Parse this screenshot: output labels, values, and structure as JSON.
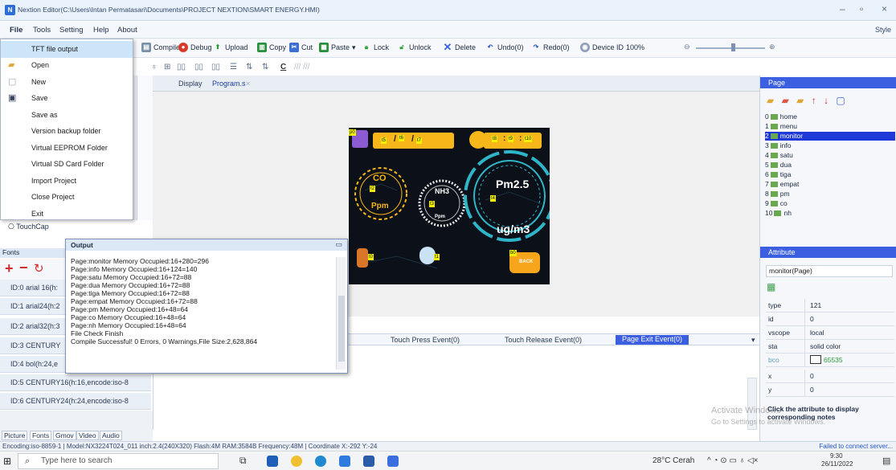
{
  "window": {
    "title": "Nextion Editor(C:\\Users\\Intan Permatasari\\Documents\\PROJECT NEXTION\\SMART ENERGY.HMI)",
    "style_label": "Style"
  },
  "menu": [
    "File",
    "Tools",
    "Setting",
    "Help",
    "About"
  ],
  "toolbar": {
    "compile": "Compile",
    "debug": "Debug",
    "upload": "Upload",
    "copy": "Copy",
    "cut": "Cut",
    "paste": "Paste",
    "lock": "Lock",
    "unlock": "Unlock",
    "delete": "Delete",
    "undo": "Undo(0)",
    "redo": "Redo(0)",
    "device_id": "Device ID",
    "zoom": "100%"
  },
  "file_menu": [
    {
      "label": "TFT file output",
      "icon": "none"
    },
    {
      "label": "Open",
      "icon": "folder-icon"
    },
    {
      "label": "New",
      "icon": "new-file-icon"
    },
    {
      "label": "Save",
      "icon": "save-icon"
    },
    {
      "label": "Save as",
      "icon": "none"
    },
    {
      "label": "Version backup folder",
      "icon": "none"
    },
    {
      "label": "Virtual EEPROM Folder",
      "icon": "none"
    },
    {
      "label": "Virtual SD Card Folder",
      "icon": "none"
    },
    {
      "label": "Import Project",
      "icon": "none"
    },
    {
      "label": "Close Project",
      "icon": "none"
    },
    {
      "label": "Exit",
      "icon": "none"
    }
  ],
  "toolbox": {
    "touchcap": "TouchCap"
  },
  "fonts_panel": {
    "header": "Fonts",
    "rows": [
      "ID:0 arial 16(h:",
      "ID:1 arial24(h:2",
      "ID:2 arial32(h:3",
      "ID:3 CENTURY",
      "ID:4 bol(h:24,e",
      "ID:5 CENTURY16(h:16,encode:iso-8",
      "ID:6 CENTURY24(h:24,encode:iso-8"
    ],
    "tabs": [
      "Picture",
      "Fonts",
      "Gmov",
      "Video",
      "Audio"
    ]
  },
  "doc_tabs": [
    "Display",
    "Program.s"
  ],
  "hmi_screen": {
    "date_tags": [
      "t5",
      "t6",
      "t7"
    ],
    "time_tags": [
      "t8",
      "t9",
      "t10"
    ],
    "co_label": "CO",
    "co_unit": "Ppm",
    "nh3_label": "NH3",
    "nh3_unit": "Ppm",
    "pm_label": "Pm2.5",
    "pm_unit": "ug/m3",
    "back_label": "BACK",
    "tag_t0": "t0",
    "tag_t2": "t2",
    "tag_t3": "t3",
    "tag_t4": "t4",
    "tag_t1": "t1",
    "tag_b0": "b0",
    "tag_p0": "p0"
  },
  "events": {
    "tabs": [
      "Touch Press Event(0)",
      "Touch Release Event(0)",
      "Page Exit Event(0)"
    ],
    "active": "Page Exit Event(0)"
  },
  "output": {
    "title": "Output",
    "lines": [
      "Page:monitor Memory Occupied:16+280=296",
      "Page:info Memory Occupied:16+124=140",
      "Page:satu Memory Occupied:16+72=88",
      "Page:dua Memory Occupied:16+72=88",
      "Page:tiga Memory Occupied:16+72=88",
      "Page:empat Memory Occupied:16+72=88",
      "Page:pm Memory Occupied:16+48=64",
      "Page:co Memory Occupied:16+48=64",
      "Page:nh Memory Occupied:16+48=64",
      "File Check Finish",
      "Compile Successful! 0 Errors, 0 Warnings,File Size:2,628,864"
    ]
  },
  "page_panel": {
    "header": "Page",
    "pages": [
      {
        "index": "0",
        "name": "home"
      },
      {
        "index": "1",
        "name": "menu"
      },
      {
        "index": "2",
        "name": "monitor"
      },
      {
        "index": "3",
        "name": "info"
      },
      {
        "index": "4",
        "name": "satu"
      },
      {
        "index": "5",
        "name": "dua"
      },
      {
        "index": "6",
        "name": "tiga"
      },
      {
        "index": "7",
        "name": "empat"
      },
      {
        "index": "8",
        "name": "pm"
      },
      {
        "index": "9",
        "name": "co"
      },
      {
        "index": "10",
        "name": "nh"
      }
    ],
    "selected": "monitor"
  },
  "attribute_panel": {
    "header": "Attribute",
    "object": "monitor(Page)",
    "rows": [
      {
        "key": "type",
        "value": "121"
      },
      {
        "key": "id",
        "value": "0"
      },
      {
        "key": "vscope",
        "value": "local"
      },
      {
        "key": "sta",
        "value": "solid color"
      },
      {
        "key": "bco",
        "value": "65535"
      },
      {
        "key": "x",
        "value": "0"
      },
      {
        "key": "y",
        "value": "0"
      }
    ],
    "hint": "Click the attribute to display corresponding notes"
  },
  "status_bar": {
    "left": "Encoding:iso-8859-1 | Model:NX3224T024_011 inch:2.4(240X320) Flash:4M RAM:3584B Frequency:48M | Coordinate X:-292 Y:-24",
    "right": "Failed to connect server..."
  },
  "watermark": {
    "line1": "Activate Windows",
    "line2": "Go to Settings to activate Windows."
  },
  "taskbar": {
    "search_placeholder": "Type here to search",
    "weather": "28°C Cerah",
    "time": "9:30",
    "date": "26/11/2022"
  },
  "colors": {
    "accent_blue": "#3b5fe0",
    "selection": "#1f39d8",
    "hmi_orange": "#f7b71a",
    "hmi_teal": "#2fb5c8"
  }
}
